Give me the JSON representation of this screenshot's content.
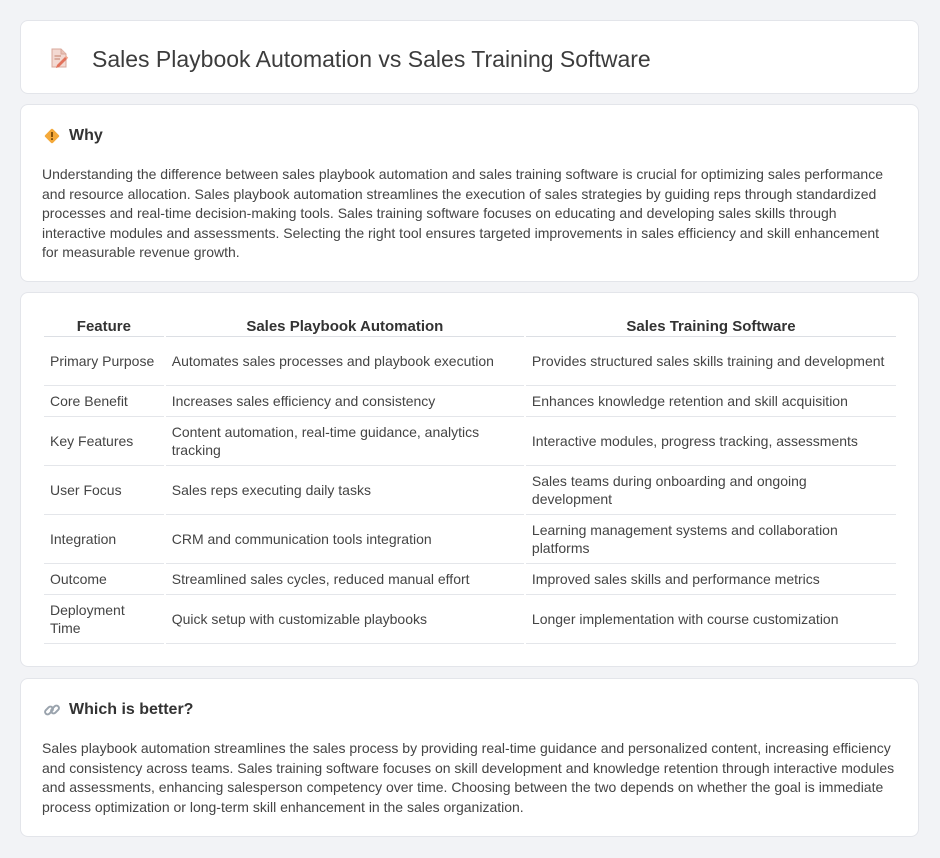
{
  "header": {
    "title": "Sales Playbook Automation vs Sales Training Software",
    "icon": "document-edit-icon"
  },
  "why": {
    "icon": "diamond-warning-icon",
    "title": "Why",
    "text": "Understanding the difference between sales playbook automation and sales training software is crucial for optimizing sales performance and resource allocation. Sales playbook automation streamlines the execution of sales strategies by guiding reps through standardized processes and real-time decision-making tools. Sales training software focuses on educating and developing sales skills through interactive modules and assessments. Selecting the right tool ensures targeted improvements in sales efficiency and skill enhancement for measurable revenue growth."
  },
  "table": {
    "headers": [
      "Feature",
      "Sales Playbook Automation",
      "Sales Training Software"
    ],
    "rows": [
      [
        "Primary Purpose",
        "Automates sales processes and playbook execution",
        "Provides structured sales skills training and development"
      ],
      [
        "Core Benefit",
        "Increases sales efficiency and consistency",
        "Enhances knowledge retention and skill acquisition"
      ],
      [
        "Key Features",
        "Content automation, real-time guidance, analytics tracking",
        "Interactive modules, progress tracking, assessments"
      ],
      [
        "User Focus",
        "Sales reps executing daily tasks",
        "Sales teams during onboarding and ongoing development"
      ],
      [
        "Integration",
        "CRM and communication tools integration",
        "Learning management systems and collaboration platforms"
      ],
      [
        "Outcome",
        "Streamlined sales cycles, reduced manual effort",
        "Improved sales skills and performance metrics"
      ],
      [
        "Deployment Time",
        "Quick setup with customizable playbooks",
        "Longer implementation with course customization"
      ]
    ]
  },
  "better": {
    "icon": "link-icon",
    "title": "Which is better?",
    "text": "Sales playbook automation streamlines the sales process by providing real-time guidance and personalized content, increasing efficiency and consistency across teams. Sales training software focuses on skill development and knowledge retention through interactive modules and assessments, enhancing salesperson competency over time. Choosing between the two depends on whether the goal is immediate process optimization or long-term skill enhancement in the sales organization."
  }
}
